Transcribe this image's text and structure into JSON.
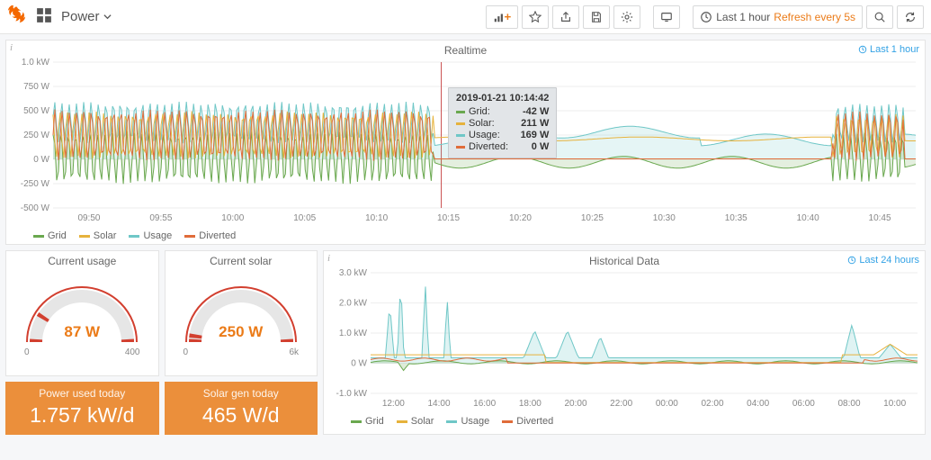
{
  "header": {
    "title": "Power",
    "timerange_label": "Last 1 hour",
    "refresh_label": "Refresh every 5s"
  },
  "realtime": {
    "title": "Realtime",
    "timerange": "Last 1 hour",
    "tooltip": {
      "timestamp": "2019-01-21 10:14:42",
      "rows": [
        {
          "name": "Grid:",
          "value": "-42 W",
          "color": "#6aa84f"
        },
        {
          "name": "Solar:",
          "value": "211 W",
          "color": "#e6b23c"
        },
        {
          "name": "Usage:",
          "value": "169 W",
          "color": "#6fc7c7"
        },
        {
          "name": "Diverted:",
          "value": "0 W",
          "color": "#e06c3a"
        }
      ]
    },
    "legend": [
      {
        "name": "Grid",
        "color": "#6aa84f"
      },
      {
        "name": "Solar",
        "color": "#e6b23c"
      },
      {
        "name": "Usage",
        "color": "#6fc7c7"
      },
      {
        "name": "Diverted",
        "color": "#e06c3a"
      }
    ]
  },
  "gauges": {
    "usage": {
      "title": "Current usage",
      "value": "87 W",
      "min": "0",
      "max": "400",
      "frac": 0.18
    },
    "solar": {
      "title": "Current solar",
      "value": "250 W",
      "min": "0",
      "max": "6k",
      "frac": 0.04
    }
  },
  "stats": {
    "power_used": {
      "title": "Power used today",
      "value": "1.757 kW/d"
    },
    "solar_gen": {
      "title": "Solar gen today",
      "value": "465 W/d"
    }
  },
  "historical": {
    "title": "Historical Data",
    "timerange": "Last 24 hours",
    "legend": [
      {
        "name": "Grid",
        "color": "#6aa84f"
      },
      {
        "name": "Solar",
        "color": "#e6b23c"
      },
      {
        "name": "Usage",
        "color": "#6fc7c7"
      },
      {
        "name": "Diverted",
        "color": "#e06c3a"
      }
    ]
  },
  "chart_data": [
    {
      "id": "realtime",
      "type": "line",
      "title": "Realtime",
      "xlabel": "",
      "ylabel": "",
      "ylim": [
        -500,
        1000
      ],
      "y_ticks": [
        "-500 W",
        "-250 W",
        "0 W",
        "250 W",
        "500 W",
        "750 W",
        "1.0 kW"
      ],
      "x_ticks": [
        "09:50",
        "09:55",
        "10:00",
        "10:05",
        "10:10",
        "10:15",
        "10:20",
        "10:25",
        "10:30",
        "10:35",
        "10:40",
        "10:45"
      ],
      "cursor_x": "10:15",
      "series": [
        {
          "name": "Grid",
          "color": "#6aa84f",
          "approx_range": [
            -250,
            300
          ],
          "note": "rapid oscillation ±250W with spikes"
        },
        {
          "name": "Solar",
          "color": "#e6b23c",
          "approx_range": [
            0,
            500
          ],
          "note": "rapid oscillation 0–500W first half, ~200W steady after 10:15"
        },
        {
          "name": "Usage",
          "color": "#6fc7c7",
          "approx_range": [
            150,
            650
          ],
          "note": "oscillating 200–600W then ~170–300W steady after 10:15, burst 10:38–10:45"
        },
        {
          "name": "Diverted",
          "color": "#e06c3a",
          "approx_range": [
            0,
            500
          ],
          "note": "oscillating 0–500W first half, ~0W after 10:15"
        }
      ]
    },
    {
      "id": "historical",
      "type": "line",
      "title": "Historical Data",
      "xlabel": "",
      "ylabel": "",
      "ylim": [
        -1.0,
        3.0
      ],
      "y_ticks": [
        "-1.0 kW",
        "0 W",
        "1.0 kW",
        "2.0 kW",
        "3.0 kW"
      ],
      "x_ticks": [
        "12:00",
        "14:00",
        "16:00",
        "18:00",
        "20:00",
        "22:00",
        "00:00",
        "02:00",
        "04:00",
        "06:00",
        "08:00",
        "10:00"
      ],
      "series": [
        {
          "name": "Grid",
          "color": "#6aa84f",
          "approx": "near 0 with small dips/rises"
        },
        {
          "name": "Solar",
          "color": "#e6b23c",
          "approx": "~0.3kW daytime, 0 at night, rises toward end"
        },
        {
          "name": "Usage",
          "color": "#6fc7c7",
          "approx": "baseline ~0.2kW with spikes to 2.7kW around 12:30/13:30/14:30, ~1kW spikes 18:00–21:00, ~1.2kW spike 08:30"
        },
        {
          "name": "Diverted",
          "color": "#e06c3a",
          "approx": "mostly 0, small bumps daytime"
        }
      ]
    }
  ]
}
